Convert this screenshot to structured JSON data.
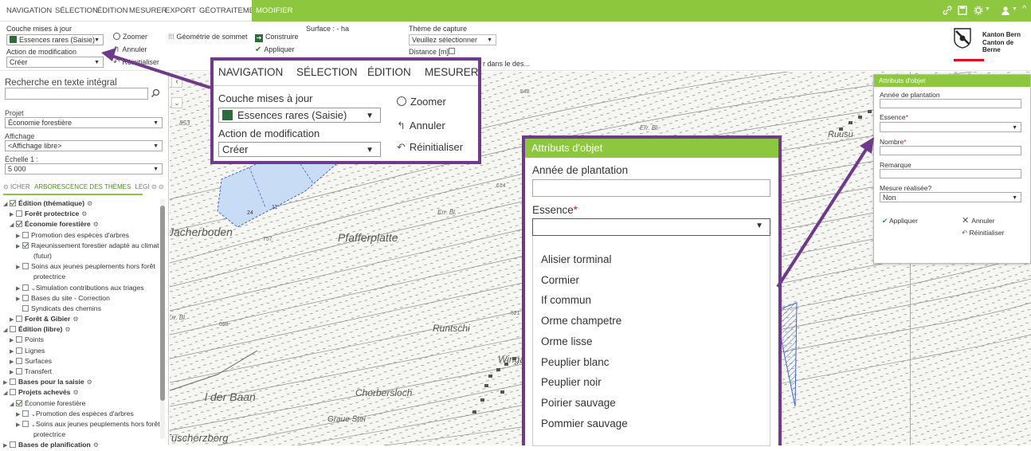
{
  "menu": {
    "items": [
      "NAVIGATION",
      "SÉLECTION",
      "ÉDITION",
      "MESURER",
      "EXPORT",
      "GÉOTRAITEMENT"
    ],
    "active": "MODIFIER",
    "accent": "#8dc63f"
  },
  "toolbar": {
    "layer_label": "Couche mises à jour",
    "layer_value": "Essences rares (Saisie)",
    "action_label": "Action de modification",
    "action_value": "Créer",
    "zoom": "Zoomer",
    "cancel": "Annuler",
    "reset": "Réinitialiser",
    "geometry": "Géométrie de sommet",
    "build": "Construire",
    "apply": "Appliquer",
    "surface": "Surface : - ha",
    "capture_theme": "Thème de capture",
    "capture_value": "Veuillez sélectionner",
    "distance": "Distance [m]",
    "partial": "r dans le des..."
  },
  "brand": {
    "line1": "Kanton Bern",
    "line2": "Canton de Berne",
    "stripe": "#e3001b"
  },
  "left": {
    "search_label": "Recherche en texte intégral",
    "project_label": "Projet",
    "project_value": "Économie forestière",
    "display_label": "Affichage",
    "display_value": "<Affichage libre>",
    "scale_label": "Échelle 1 :",
    "scale_value": "5 000",
    "tab_prev": "ICHER",
    "tab_active": "ARBORESCENCE DES THÈMES",
    "tab_next": "LÉGI",
    "tree": [
      {
        "t": "Édition (thématique)",
        "lvl": 0,
        "cb": true,
        "bold": true,
        "open": true,
        "gear": true
      },
      {
        "t": "Forêt protectrice",
        "lvl": 1,
        "cb": false,
        "bold": true,
        "gear": true
      },
      {
        "t": "Économie forestière",
        "lvl": 1,
        "cb": true,
        "bold": true,
        "open": true,
        "gear": true
      },
      {
        "t": "Promotion des espèces d'arbres",
        "lvl": 2,
        "cb": false
      },
      {
        "t": "Rajeunissement forestier adapté au climat",
        "lvl": 2,
        "cb": true
      },
      {
        "t": "(futur)",
        "lvl": 3,
        "cont": true
      },
      {
        "t": "Soins aux jeunes peuplements hors forêt",
        "lvl": 2,
        "cb": false
      },
      {
        "t": "protectrice",
        "lvl": 3,
        "cont": true
      },
      {
        "t": "Simulation contributions aux triages",
        "lvl": 2,
        "cb": false,
        "vee": true
      },
      {
        "t": "Bases du site - Correction",
        "lvl": 2,
        "cb": false
      },
      {
        "t": "Syndicats des chemins",
        "lvl": 2,
        "cb": false,
        "notri": true
      },
      {
        "t": "Forêt & Gibier",
        "lvl": 1,
        "cb": false,
        "bold": true,
        "gear": true
      },
      {
        "t": "Édition (libre)",
        "lvl": 0,
        "cb": false,
        "bold": true,
        "open": true,
        "gear": true
      },
      {
        "t": "Points",
        "lvl": 1,
        "cb": false
      },
      {
        "t": "Lignes",
        "lvl": 1,
        "cb": false
      },
      {
        "t": "Surfaces",
        "lvl": 1,
        "cb": false
      },
      {
        "t": "Transfert",
        "lvl": 1,
        "cb": false
      },
      {
        "t": "Bases pour la saisie",
        "lvl": 0,
        "cb": false,
        "bold": true,
        "gear": true
      },
      {
        "t": "Projets achevés",
        "lvl": 0,
        "cb": false,
        "bold": true,
        "open": true,
        "gear": true
      },
      {
        "t": "Économie forestière",
        "lvl": 1,
        "cb": true,
        "open": true
      },
      {
        "t": "Promotion des espèces d'arbres",
        "lvl": 2,
        "cb": false,
        "vee": true
      },
      {
        "t": "Soins aux jeunes peuplements hors forêt",
        "lvl": 2,
        "cb": false,
        "vee": true
      },
      {
        "t": "protectrice",
        "lvl": 3,
        "cont": true
      },
      {
        "t": "Bases de planification",
        "lvl": 0,
        "cb": false,
        "bold": true,
        "gear": true
      }
    ]
  },
  "map_labels": [
    "853",
    "Err. Bl.",
    "Ruusu",
    "24",
    "11",
    "Jacherboden",
    "757",
    "Pfafferplatte",
    "Err. Bl.",
    "614",
    "548",
    "Err. Bl.",
    "698",
    "Runtschi",
    "521",
    "Wingarte",
    "l der Baan",
    "Chorbersloch",
    "Graue Stei",
    "Tüscherzberg"
  ],
  "callout_menu": {
    "tabs": [
      "NAVIGATION",
      "SÉLECTION",
      "ÉDITION",
      "MESURER"
    ],
    "layer_label": "Couche mises à jour",
    "layer_value": "Essences rares (Saisie)",
    "action_label": "Action de modification",
    "action_value": "Créer",
    "zoom": "Zoomer",
    "cancel": "Annuler",
    "reset": "Réinitialiser"
  },
  "attr_small": {
    "title": "Attributs d'objet",
    "year_label": "Année de plantation",
    "essence_label": "Essence",
    "number_label": "Nombre",
    "remark_label": "Remarque",
    "done_label": "Mesure réalisée?",
    "done_value": "Non",
    "apply": "Appliquer",
    "cancel": "Annuler",
    "reset": "Réinitialiser"
  },
  "attr_big": {
    "title": "Attributs d'objet",
    "year_label": "Année de plantation",
    "essence_label": "Essence",
    "options": [
      "Alisier torminal",
      "Cormier",
      "If commun",
      "Orme champetre",
      "Orme lisse",
      "Peuplier blanc",
      "Peuplier noir",
      "Poirier sauvage",
      "Pommier sauvage"
    ]
  },
  "colors": {
    "purple": "#6f3a8a",
    "polygon_fill": "#c9dcf6",
    "polygon_stroke": "#3d66c8",
    "required": "#d9201c"
  }
}
